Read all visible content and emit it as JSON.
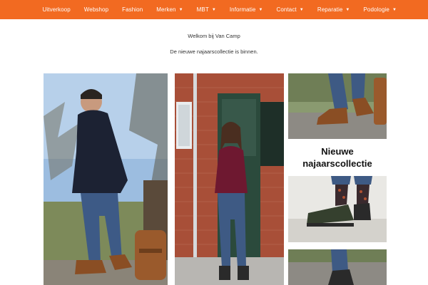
{
  "nav": {
    "items": [
      {
        "label": "Uitverkoop",
        "dropdown": false
      },
      {
        "label": "Webshop",
        "dropdown": false
      },
      {
        "label": "Fashion",
        "dropdown": false
      },
      {
        "label": "Merken",
        "dropdown": true
      },
      {
        "label": "MBT",
        "dropdown": true
      },
      {
        "label": "Informatie",
        "dropdown": true
      },
      {
        "label": "Contact",
        "dropdown": true
      },
      {
        "label": "Reparatie",
        "dropdown": true
      },
      {
        "label": "Podologie",
        "dropdown": true
      }
    ],
    "caret": "▼",
    "bg_color": "#f26a21"
  },
  "intro": {
    "welcome": "Welkom bij Van Camp",
    "tagline": "De nieuwe najaarscollectie is binnen."
  },
  "gallery": {
    "promo_line1": "Nieuwe",
    "promo_line2": "najaarscollectie"
  }
}
